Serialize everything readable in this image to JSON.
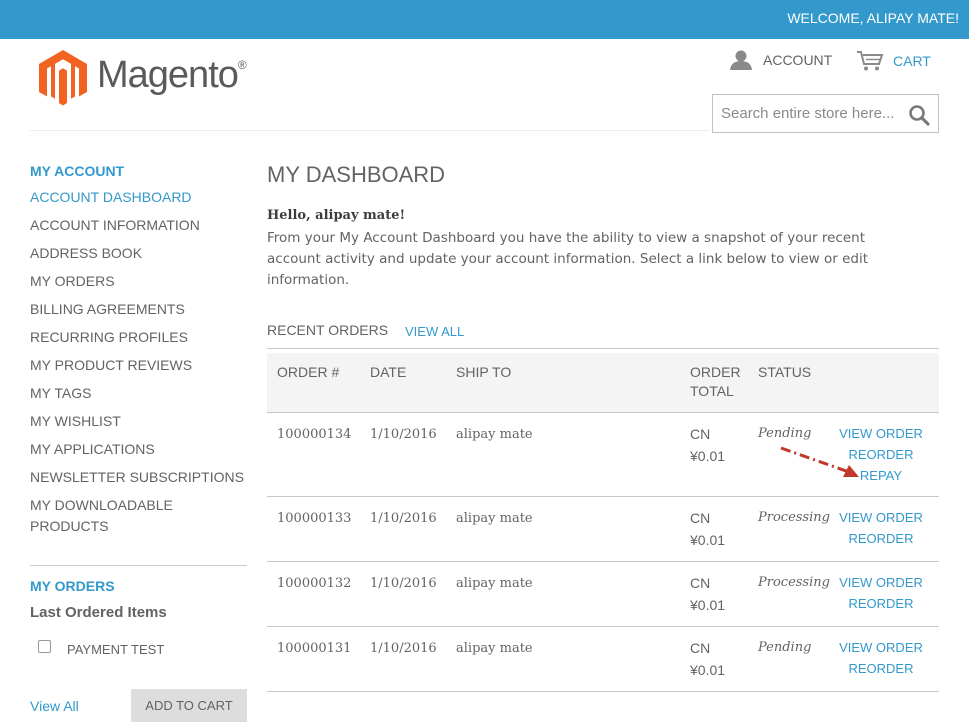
{
  "header": {
    "welcome": "WELCOME, ALIPAY MATE!",
    "logo_text": "Magento",
    "logo_mark": "®",
    "account_label": "ACCOUNT",
    "cart_label": "CART",
    "search_placeholder": "Search entire store here..."
  },
  "sidebar": {
    "title": "MY ACCOUNT",
    "items": [
      {
        "label": "ACCOUNT DASHBOARD",
        "active": true
      },
      {
        "label": "ACCOUNT INFORMATION"
      },
      {
        "label": "ADDRESS BOOK"
      },
      {
        "label": "MY ORDERS"
      },
      {
        "label": "BILLING AGREEMENTS"
      },
      {
        "label": "RECURRING PROFILES"
      },
      {
        "label": "MY PRODUCT REVIEWS"
      },
      {
        "label": "MY TAGS"
      },
      {
        "label": "MY WISHLIST"
      },
      {
        "label": "MY APPLICATIONS"
      },
      {
        "label": "NEWSLETTER SUBSCRIPTIONS"
      },
      {
        "label": "MY DOWNLOADABLE PRODUCTS"
      }
    ],
    "orders_title": "MY ORDERS",
    "last_ordered": "Last Ordered Items",
    "last_item": "PAYMENT TEST",
    "view_all": "View All",
    "add_to_cart": "ADD TO CART"
  },
  "main": {
    "title": "MY DASHBOARD",
    "hello": "Hello, alipay mate!",
    "intro": "From your My Account Dashboard you have the ability to view a snapshot of your recent account activity and update your account information. Select a link below to view or edit information.",
    "recent_orders": "RECENT ORDERS",
    "view_all": "VIEW ALL",
    "columns": {
      "order": "ORDER #",
      "date": "DATE",
      "ship_to": "SHIP TO",
      "order_total_1": "ORDER",
      "order_total_2": "TOTAL",
      "status": "STATUS"
    },
    "orders": [
      {
        "number": "100000134",
        "date": "1/10/2016",
        "ship_to": "alipay mate",
        "currency": "CN",
        "total": "¥0.01",
        "status": "Pending",
        "view": "VIEW ORDER",
        "reorder": "REORDER",
        "repay": "REPAY"
      },
      {
        "number": "100000133",
        "date": "1/10/2016",
        "ship_to": "alipay mate",
        "currency": "CN",
        "total": "¥0.01",
        "status": "Processing",
        "view": "VIEW ORDER",
        "reorder": "REORDER"
      },
      {
        "number": "100000132",
        "date": "1/10/2016",
        "ship_to": "alipay mate",
        "currency": "CN",
        "total": "¥0.01",
        "status": "Processing",
        "view": "VIEW ORDER",
        "reorder": "REORDER"
      },
      {
        "number": "100000131",
        "date": "1/10/2016",
        "ship_to": "alipay mate",
        "currency": "CN",
        "total": "¥0.01",
        "status": "Pending",
        "view": "VIEW ORDER",
        "reorder": "REORDER"
      }
    ]
  },
  "colors": {
    "accent": "#3399cc",
    "text": "#636363",
    "logo_orange": "#f26322",
    "annotation_arrow": "#c0392b"
  }
}
